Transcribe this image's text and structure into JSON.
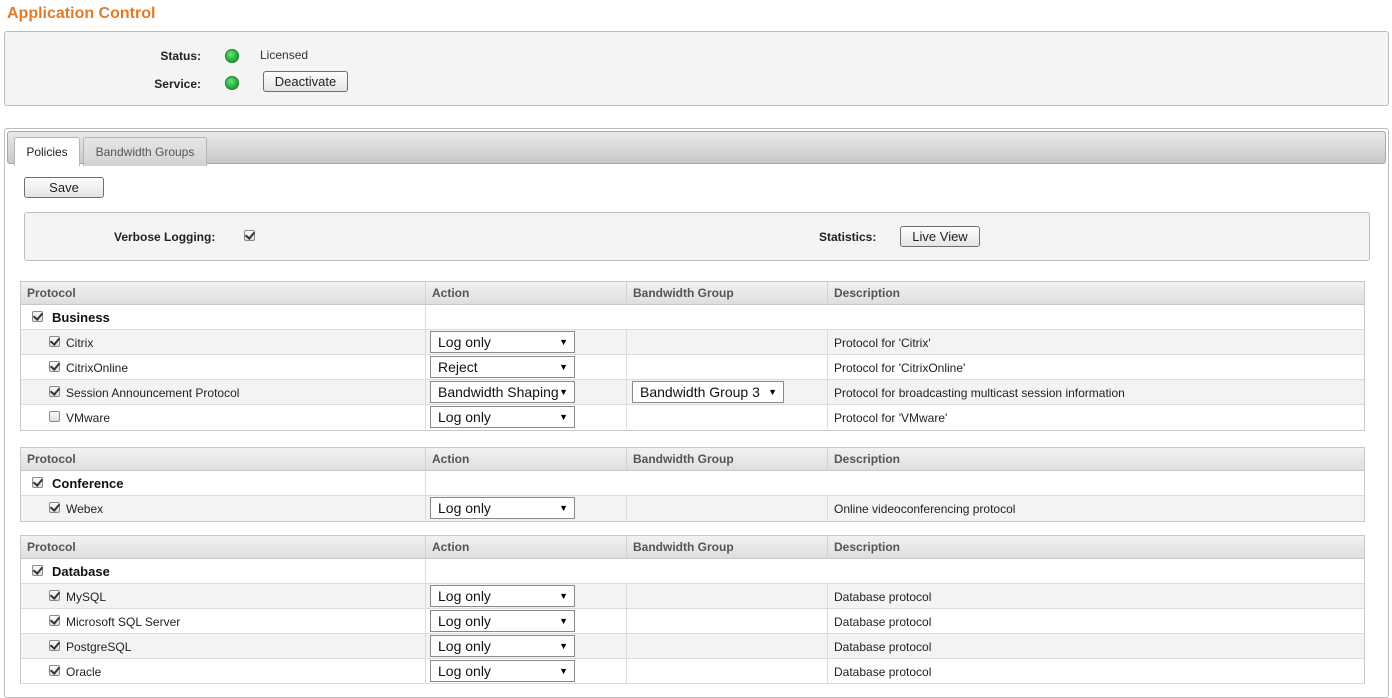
{
  "page": {
    "title": "Application Control"
  },
  "status": {
    "status_label": "Status:",
    "status_value": "Licensed",
    "service_label": "Service:",
    "deactivate_label": "Deactivate"
  },
  "tabs": [
    {
      "label": "Policies",
      "active": true
    },
    {
      "label": "Bandwidth Groups",
      "active": false
    }
  ],
  "toolbar": {
    "save_label": "Save"
  },
  "logging": {
    "verbose_label": "Verbose Logging:",
    "verbose_checked": true,
    "statistics_label": "Statistics:",
    "live_view_label": "Live View"
  },
  "columns": {
    "protocol": "Protocol",
    "action": "Action",
    "bandwidth_group": "Bandwidth Group",
    "description": "Description"
  },
  "groups": [
    {
      "name": "Business",
      "checked": true,
      "rows": [
        {
          "protocol": "Citrix",
          "checked": true,
          "action": "Log only",
          "bandwidth_group": "",
          "description": "Protocol for 'Citrix'"
        },
        {
          "protocol": "CitrixOnline",
          "checked": true,
          "action": "Reject",
          "bandwidth_group": "",
          "description": "Protocol for 'CitrixOnline'"
        },
        {
          "protocol": "Session Announcement Protocol",
          "checked": true,
          "action": "Bandwidth Shaping",
          "bandwidth_group": "Bandwidth Group 3",
          "description": "Protocol for broadcasting multicast session information"
        },
        {
          "protocol": "VMware",
          "checked": false,
          "action": "Log only",
          "bandwidth_group": "",
          "description": "Protocol for 'VMware'"
        }
      ]
    },
    {
      "name": "Conference",
      "checked": true,
      "rows": [
        {
          "protocol": "Webex",
          "checked": true,
          "action": "Log only",
          "bandwidth_group": "",
          "description": "Online videoconferencing protocol"
        }
      ]
    },
    {
      "name": "Database",
      "checked": true,
      "rows": [
        {
          "protocol": "MySQL",
          "checked": true,
          "action": "Log only",
          "bandwidth_group": "",
          "description": "Database protocol"
        },
        {
          "protocol": "Microsoft SQL Server",
          "checked": true,
          "action": "Log only",
          "bandwidth_group": "",
          "description": "Database protocol"
        },
        {
          "protocol": "PostgreSQL",
          "checked": true,
          "action": "Log only",
          "bandwidth_group": "",
          "description": "Database protocol"
        },
        {
          "protocol": "Oracle",
          "checked": true,
          "action": "Log only",
          "bandwidth_group": "",
          "description": "Database protocol"
        }
      ]
    }
  ],
  "colors": {
    "title": "#e07b2a",
    "led": "#28b33a"
  },
  "icons": {
    "status_led": "green-led-icon",
    "dropdown": "dropdown-arrow-icon",
    "check": "checkbox-check-icon"
  }
}
